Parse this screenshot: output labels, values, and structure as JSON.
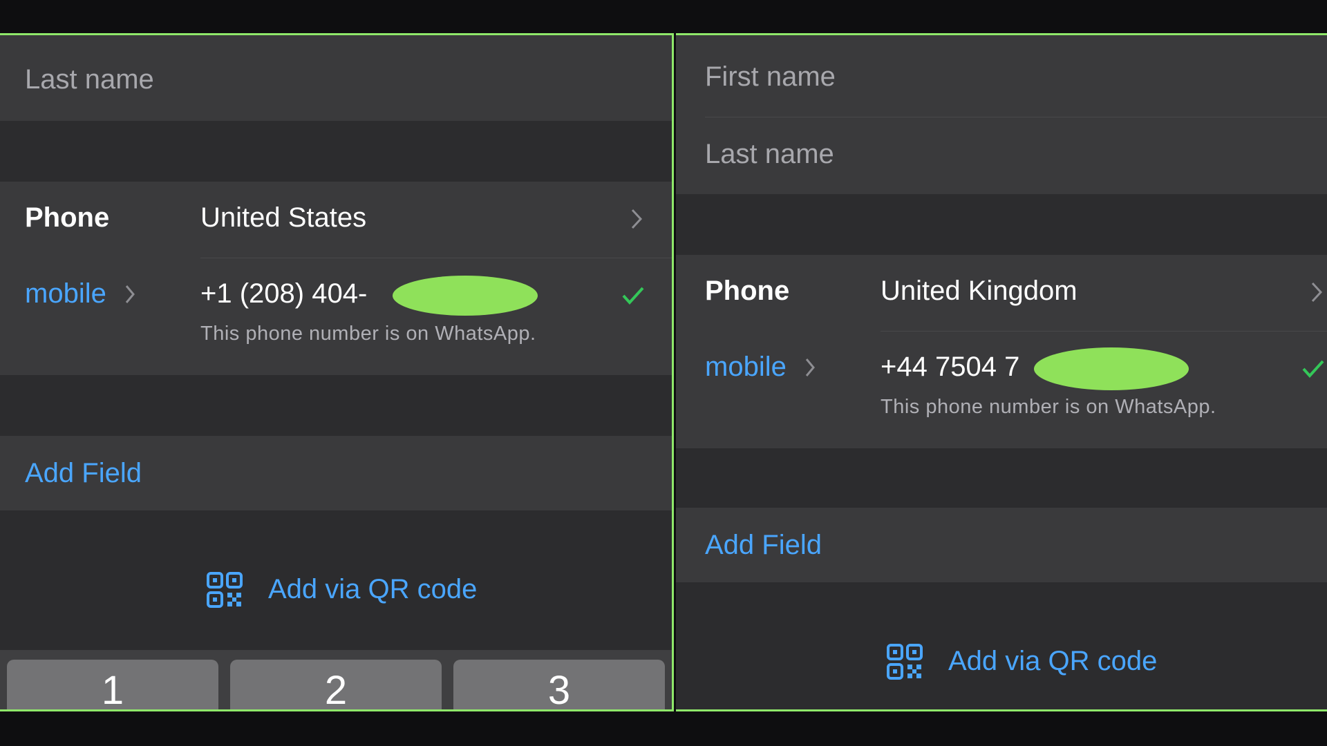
{
  "left": {
    "last_name_placeholder": "Last name",
    "phone_label": "Phone",
    "country": "United States",
    "phone_type": "mobile",
    "phone_number": "+1  (208) 404-",
    "whatsapp_note": "This phone number is on WhatsApp.",
    "add_field": "Add Field",
    "add_qr": "Add via QR code",
    "keypad": [
      "1",
      "2",
      "3"
    ]
  },
  "right": {
    "first_name_placeholder": "First name",
    "last_name_placeholder": "Last name",
    "phone_label": "Phone",
    "country": "United Kingdom",
    "phone_type": "mobile",
    "phone_number": "+44  7504 7",
    "whatsapp_note": "This phone number is on WhatsApp.",
    "add_field": "Add Field",
    "add_qr": "Add via QR code"
  },
  "colors": {
    "accent": "#4aa6ff",
    "check": "#34c759",
    "highlight": "#8fe86a",
    "redaction": "#8fe15a"
  },
  "icons": [
    "chevron-right-icon",
    "checkmark-icon",
    "qr-code-icon"
  ]
}
